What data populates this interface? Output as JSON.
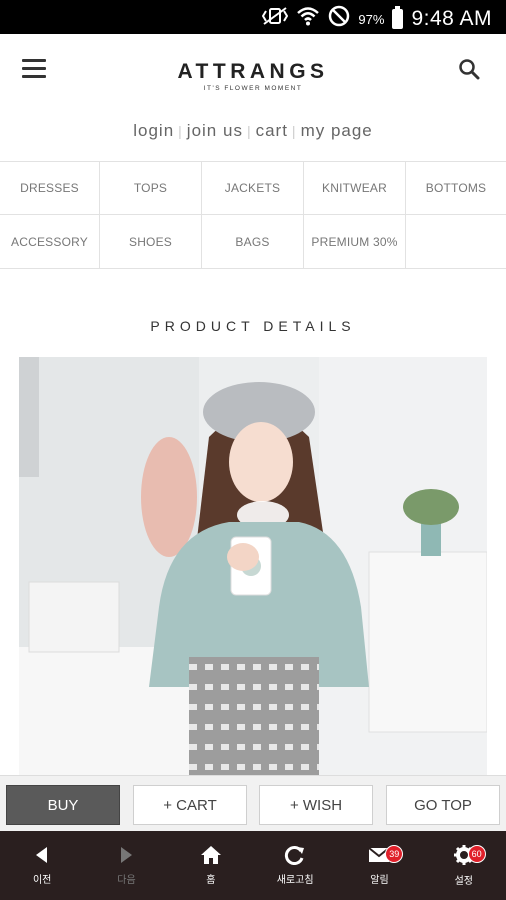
{
  "status_bar": {
    "icons": [
      "vibrate-icon",
      "wifi-icon",
      "do-not-disturb-icon",
      "battery-icon"
    ],
    "battery": "97",
    "battery_unit": "%",
    "time": "9:48 AM"
  },
  "header": {
    "logo": "ATTRANGS",
    "tagline": "IT'S FLOWER MOMENT"
  },
  "top_links": [
    "login",
    "join us",
    "cart",
    "my page"
  ],
  "categories": [
    "DRESSES",
    "TOPS",
    "JACKETS",
    "KNITWEAR",
    "BOTTOMS",
    "ACCESSORY",
    "SHOES",
    "BAGS",
    "PREMIUM 30%",
    ""
  ],
  "section_title": "PRODUCT DETAILS",
  "actions": {
    "buy": "BUY",
    "cart": "+ CART",
    "wish": "+ WISH",
    "top": "GO TOP"
  },
  "bottom_nav": [
    {
      "label": "이전",
      "icon": "back-icon"
    },
    {
      "label": "다음",
      "icon": "forward-icon"
    },
    {
      "label": "홈",
      "icon": "home-icon"
    },
    {
      "label": "새로고침",
      "icon": "refresh-icon"
    },
    {
      "label": "알림",
      "icon": "mail-icon",
      "badge": "39"
    },
    {
      "label": "설정",
      "icon": "gear-icon",
      "badge": "60"
    }
  ],
  "colors": {
    "status_bar": "#000000",
    "bottom_nav": "#2a1f1f",
    "buy_button": "#5a5a5a",
    "badge": "#e0202a"
  }
}
